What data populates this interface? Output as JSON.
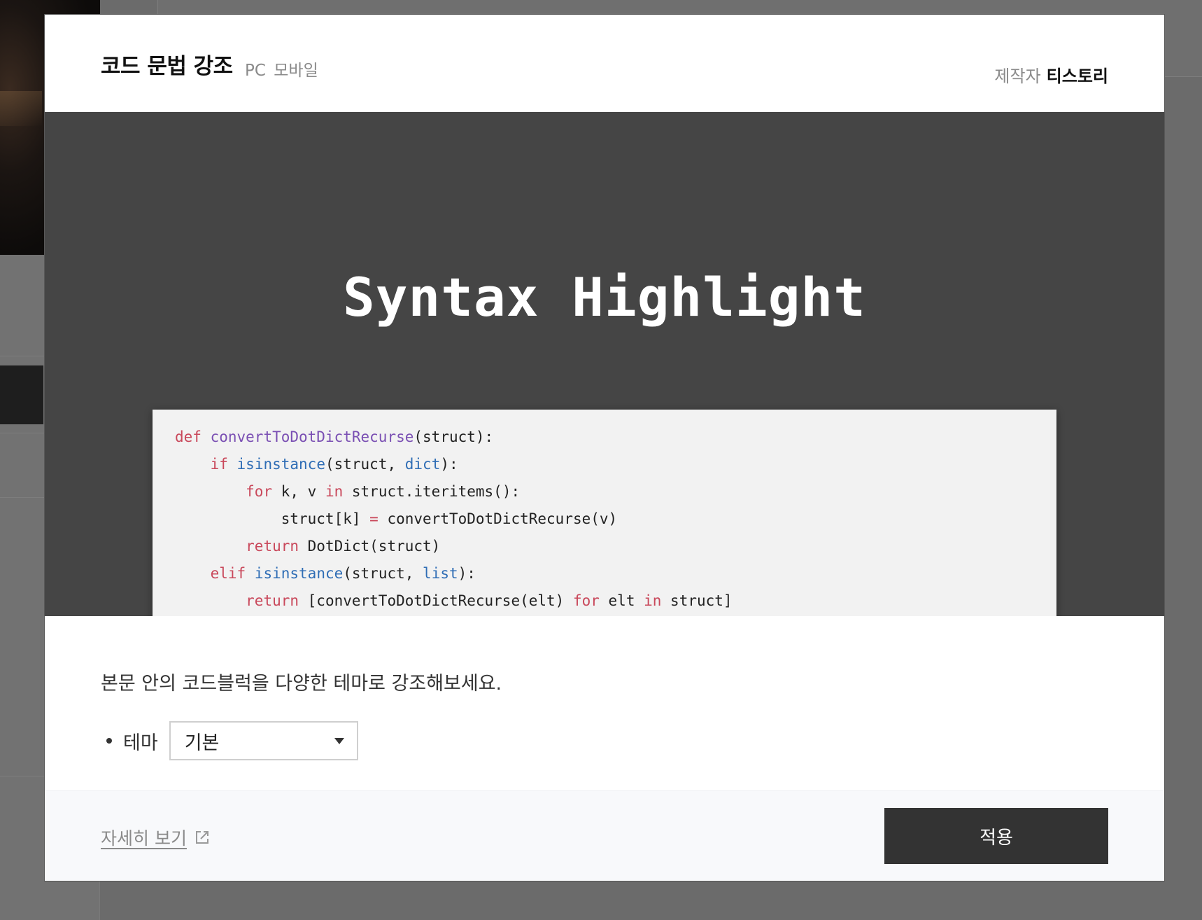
{
  "modal": {
    "title": "코드 문법 강조",
    "platforms": [
      "PC",
      "모바일"
    ],
    "maker_label": "제작자",
    "maker_name": "티스토리"
  },
  "preview": {
    "hero_title": "Syntax Highlight"
  },
  "description": "본문 안의 코드블럭을 다양한 테마로 강조해보세요.",
  "option": {
    "label": "테마",
    "selected": "기본"
  },
  "footer": {
    "detail_link": "자세히 보기",
    "apply_label": "적용"
  },
  "icons": {
    "external": "external-link-icon",
    "caret": "caret-down-icon"
  },
  "colors": {
    "keyword": "#c9485b",
    "function": "#7a4fb3",
    "builtin": "#2f6db5",
    "apply_button": "#333333",
    "preview_bg": "#454545"
  }
}
